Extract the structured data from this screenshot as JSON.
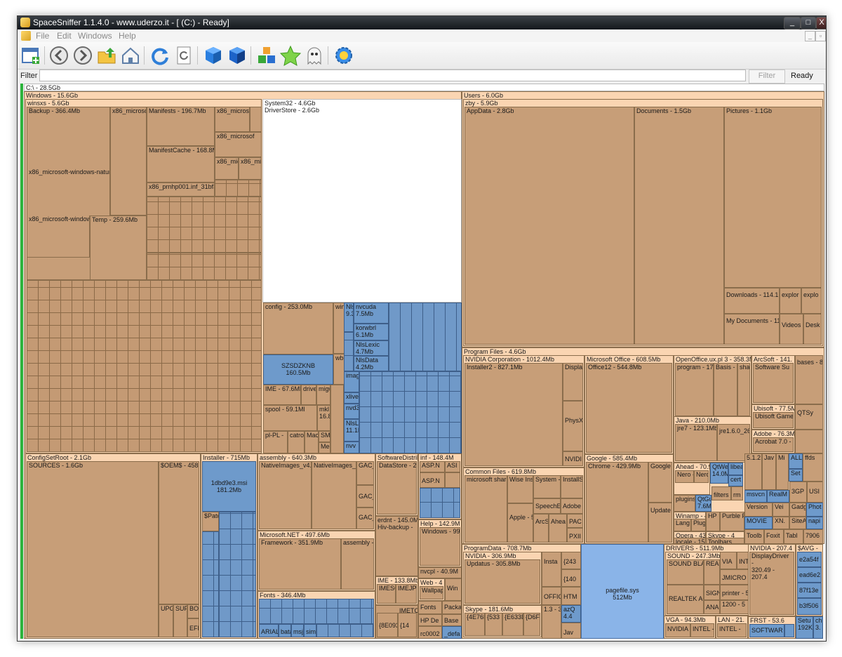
{
  "window": {
    "title": "SpaceSniffer 1.1.4.0 - www.uderzo.it - [ (C:) - Ready]",
    "caption_buttons": [
      "_",
      "□",
      "X"
    ]
  },
  "menu": {
    "items": [
      "File",
      "Edit",
      "Windows",
      "Help"
    ],
    "mdi_buttons": [
      "_",
      "▫",
      "x"
    ]
  },
  "toolbar": {
    "buttons": [
      "new-view-icon",
      "back-icon",
      "forward-icon",
      "folder-up-icon",
      "home-icon",
      "refresh-icon",
      "rescan-icon",
      "cube-icon",
      "cube-dark-icon",
      "tree-cubes-icon",
      "star-icon",
      "ghost-icon",
      "settings-gear-icon"
    ]
  },
  "filter": {
    "label": "Filter",
    "value": "",
    "button": "Filter",
    "status": "Ready"
  },
  "colors": {
    "folder_header": "#fad5b2",
    "file": "#c79e78",
    "small_file": "#6e9acb",
    "selected_file": "#8ab4e8",
    "active_bar": "#2ab23a"
  },
  "map": {
    "root": "C:\\ - 28.5Gb",
    "windows": "Windows - 15.6Gb",
    "winsxs": "winsxs - 5.6Gb",
    "backup": "Backup - 366.4Mb",
    "x86mic": "x86_microsoft",
    "manifests": "Manifests - 196.7Mb",
    "x86micro2": "x86_microsof",
    "x86micro3": "x86_microsof",
    "manifestcache": "ManifestCache - 168.8MI",
    "x86micr": "x86_micr",
    "x86mic_s": "x86_mic",
    "natural": "x86_microsoft-windows-natural",
    "prnhp": "x86_prnhp001.inf_31bf38",
    "winmsft": "x86_microsoft-windows",
    "temp": "Temp - 259.6Mb",
    "system32": "System32 - 4.6Gb",
    "driverstore": "DriverStore - 2.6Gb",
    "config": "config - 253.0Mb",
    "winevt": "winevt - 1",
    "wbem": "wbem - 70",
    "szsdzknb": "SZSDZKNB",
    "szsdzknb_size": "160.5Mb",
    "ime": "IME - 67.6Mb",
    "driverss": "drive",
    "migw": "migw",
    "spool": "spool - 59.1Ml",
    "mkl": "mkl 16.8",
    "plpl": "pl-PL -",
    "catroot": "catroc",
    "macro": "Macro",
    "smi": "SMI",
    "med": "Med",
    "nvv": "nvv",
    "nlslexi": "NlsLexi",
    "nlsd": "NlsD 9.3M",
    "nvcuda": "nvcuda 7.5Mb",
    "korwbrl": "korwbrl 6.1Mb",
    "nlslexic": "NlsLexic 4.7Mb",
    "nlsdata": "NlsData 4.2Mb",
    "image": "image",
    "xlive": "xlive.",
    "nvd3d": "nvd3d",
    "nlslexi2": "NlsLexi 11.1Ml",
    "configsetroot": "ConfigSetRoot - 2.1Gb",
    "sources": "SOURCES - 1.6Gb",
    "oems": "$OEM$ - 458.8",
    "upgr": "UPGR",
    "suf": "SUF",
    "boo": "BOO",
    "efi": "EFI",
    "installer": "Installer - 715Mb",
    "msi_name": "1dbd9e3.msi",
    "msi_size": "181.2Mb",
    "patc": "$Patc",
    "assembly": "assembly - 640.3Mb",
    "nativeimages1": "NativeImages_v4.",
    "nativeimages2": "NativeImages_v",
    "gac_m": "GAC_M",
    "gac": "GAC_",
    "gac2": "GAC_",
    "msnet": "Microsoft.NET - 497.6Mb",
    "framework": "Framework - 351.9Mb",
    "assembly2": "assembly -",
    "fonts": "Fonts - 346.4Mb",
    "arial": "ARIAL",
    "batang": "bata",
    "msjh": "msjh",
    "sims": "sims",
    "softdist": "SoftwareDistrib",
    "datastore": "DataStore - 219.",
    "erdnt": "erdnt - 145.0M",
    "hivbackup": "Hiv-backup -",
    "ime2": "IME - 133.8Mb",
    "imesc": "IMESC",
    "imejp": "IMEJP",
    "imetc": "IMETC",
    "inf": "inf - 148.4M",
    "aspn": "ASP.N",
    "asi": "ASI",
    "aspn2": "ASP.N",
    "help": "Help - 142.9M",
    "windows99": "Windows - 99.",
    "nvcpl": "nvcpl - 40.9M",
    "web": "Web - 4",
    "wallpaper": "Wallpap",
    "win": "Win",
    "fontsb": "Fonts",
    "packa": "Packa",
    "hpde": "HP De",
    "base": "Base",
    "rc0002": "rc0002",
    "defa": "_defa",
    "guid8e": "{8E09326D",
    "guid14": "{14",
    "users": "Users - 6.0Gb",
    "zby": "zby - 5.9Gb",
    "appdata": "AppData - 2.8Gb",
    "documents": "Documents - 1.5Gb",
    "pictures": "Pictures - 1.1Gb",
    "downloads": "Downloads - 114.1M",
    "explor1": "explor",
    "explor2": "explo",
    "mydocs": "My Documents - 11",
    "videos": "Videos -",
    "desk": "Desk",
    "programfiles": "Program Files - 4.6Gb",
    "nvidiacorp": "NVIDIA Corporation - 1012.4Mb",
    "installer2": "Installer2 - 827.1Mb",
    "display": "Display",
    "physx": "PhysX -",
    "nvidi": "NVIDI",
    "msoffice": "Microsoft Office - 608.5Mb",
    "office12": "Office12 - 544.8Mb",
    "openoffice": "OpenOffice.ux.pl 3 - 358.3Mb",
    "program17": "program - 17",
    "basis": "Basis - 12",
    "shar": "shar",
    "arcsoft": "ArcSoft - 141.",
    "softsu": "Software Su",
    "bases8": "bases - 8",
    "ubisoft": "Ubisoft - 77.5Mb",
    "ubigame": "Ubisoft Game L",
    "qtsy": "QTSy",
    "adobe": "Adobe - 76.3Mb",
    "acrobat": "Acrobat 7.0 - 7",
    "java": "Java - 210.0Mb",
    "jre7": "jre7 - 123.1Mb",
    "jre16": "jre1.6.0_26",
    "commonfiles": "Common Files - 619.8Mb",
    "msshared": "microsoft share",
    "wiseinst": "Wise Inst",
    "system": "System -",
    "installs": "InstallS",
    "speechen": "SpeechEn",
    "adobe2": "Adobe",
    "apple": "Apple - 5",
    "arcso": "ArcSo",
    "ahea": "Ahea",
    "pac": "PAC",
    "pxii": "PXII",
    "google": "Google - 585.4Mb",
    "chrome": "Chrome - 429.9Mb",
    "google2": "Google",
    "update": "Update",
    "ahead": "Ahead - 70.9M",
    "nero": "Nero - 4",
    "nerc": "Nerc",
    "qtwe": "QtWe 14.0M",
    "libea": "libea",
    "cert": "cert",
    "plugins": "plugins",
    "qtgu": "QtGu 7.6M",
    "filters": "filters",
    "rm": "rm -",
    "winamp": "Winamp - 4",
    "lang": "Lang",
    "plug": "Plug",
    "hp": "HP",
    "purble": "Purble Pl",
    "opera": "Opera - 43",
    "locale": "locale - 15",
    "skype": "Skype - 4",
    "toolbars": "Toolbars",
    "v51": "5.1.2",
    "jav": "Jav",
    "mi": "Mi",
    "all": "ALL",
    "set": "Set",
    "ffds": "ffds",
    "msvcr": "msvcn",
    "realm": "RealM",
    "gp3": "3GP",
    "usi": "USI",
    "version": "Version",
    "ve": "Vei",
    "gadg": "Gadg",
    "phot": "Phot",
    "movie": "MOVIE",
    "xn": "XN.",
    "sitea": "SiteA",
    "napi": "napi",
    "toolb": "Toolb",
    "foxit": "Foxit",
    "tabl": "Tabl",
    "n7906": "7906",
    "programdata": "ProgramData - 708.7Mb",
    "nvidia2": "NVIDIA - 306.9Mb",
    "updatus": "Updatus - 305.8Mb",
    "insta": "Insta",
    "g243": "{243",
    "g140": "{140",
    "offic": "OFFIC",
    "htm": "HTM",
    "v13": "1.3 - 3",
    "azq": "azQ 4.4",
    "jav2": "Jav",
    "skype2": "Skype - 181.6Mb",
    "g4e76": "{4E76FF",
    "g533": "{533",
    "ge633": "{E633D",
    "gd6f": "{D6F",
    "pagefile_name": "pagefile.sys",
    "pagefile_size": "512Mb",
    "drivers": "DRIVERS - 511.9Mb",
    "sound": "SOUND - 247.3Mb",
    "soundbla": "SOUND BLA",
    "real": "REAL",
    "via": "VIA",
    "int": "INT",
    "jmicro": "JMICRO",
    "sigm": "SIGN",
    "printer": "printer - 5",
    "realtek": "REALTEK AC",
    "anai": "ANAI",
    "v1200": "1200 - 5",
    "vga": "VGA - 94.3Mb",
    "nvidia3": "NVIDIA -",
    "intel": "INTEL -",
    "lan": "LAN - 21.",
    "intel2": "INTEL -",
    "nvidia4": "NVIDIA - 207.4",
    "displaydriver": "DisplayDriver -",
    "v320": "320.49 - 207.4",
    "savg": "$AVG -",
    "e2a54f": "e2a54f",
    "ead6e2": "ead6e2",
    "f87f13e": "87f13e",
    "b3f506": "b3f506",
    "frst": "FRST - 53.6",
    "softwar": "SOFTWAR",
    "setu": "Setu 192Kb",
    "ch": "ch 3."
  }
}
